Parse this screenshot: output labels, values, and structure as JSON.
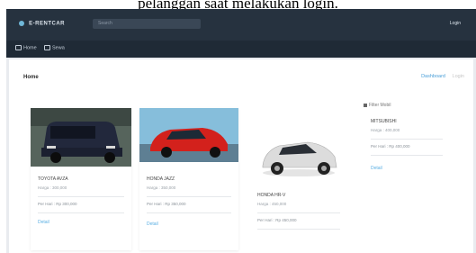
{
  "caption": "pelanggan saat melakukan login.",
  "app": {
    "logo_text": "E-RENTCAR",
    "search_placeholder": "Search",
    "login_label": "Login"
  },
  "nav": {
    "items": [
      {
        "label": "Home"
      },
      {
        "label": "Sewa"
      }
    ]
  },
  "page": {
    "title": "Home",
    "tabs": [
      {
        "label": "Dashboard",
        "active": true
      },
      {
        "label": "Login",
        "active": false
      }
    ]
  },
  "cars": [
    {
      "name": "TOYOTA AVZA",
      "meta": "Harga : 300,000",
      "price": "Per Hari : Rp 300,000",
      "detail": "Detail",
      "color": "navy-mpv"
    },
    {
      "name": "HONDA JAZZ",
      "meta": "Harga : 350,000",
      "price": "Per Hari : Rp 350,000",
      "detail": "Detail",
      "color": "red-hatch"
    },
    {
      "name": "HONDA HR-V",
      "meta": "Harga : 450,000",
      "price": "Per Hari : Rp 450,000",
      "detail": "Detail",
      "color": "white-suv"
    },
    {
      "name": "MITSUBISHI",
      "meta": "Harga : 400,000",
      "price": "Per Hari : Rp 400,000",
      "detail": "Detail",
      "color": "none"
    }
  ],
  "badge": {
    "label": "Filter Mobil"
  },
  "colors": {
    "topbar": "#26323f",
    "subbar": "#1f2a36",
    "accent": "#4a9fd8",
    "background": "#e9ebef"
  }
}
